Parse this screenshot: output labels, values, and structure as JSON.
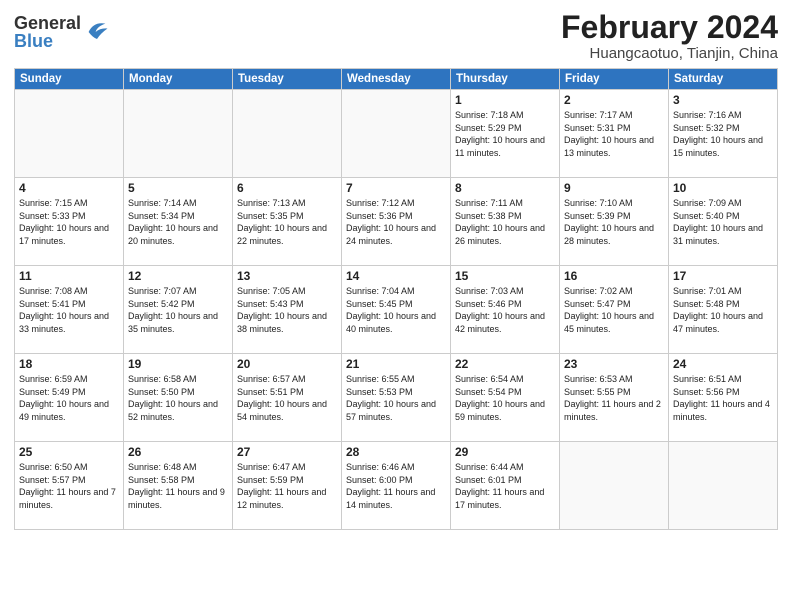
{
  "header": {
    "logo_general": "General",
    "logo_blue": "Blue",
    "month_year": "February 2024",
    "location": "Huangcaotuo, Tianjin, China"
  },
  "weekdays": [
    "Sunday",
    "Monday",
    "Tuesday",
    "Wednesday",
    "Thursday",
    "Friday",
    "Saturday"
  ],
  "weeks": [
    [
      {
        "day": "",
        "empty": true
      },
      {
        "day": "",
        "empty": true
      },
      {
        "day": "",
        "empty": true
      },
      {
        "day": "",
        "empty": true
      },
      {
        "day": "1",
        "sunrise": "7:18 AM",
        "sunset": "5:29 PM",
        "daylight": "10 hours and 11 minutes."
      },
      {
        "day": "2",
        "sunrise": "7:17 AM",
        "sunset": "5:31 PM",
        "daylight": "10 hours and 13 minutes."
      },
      {
        "day": "3",
        "sunrise": "7:16 AM",
        "sunset": "5:32 PM",
        "daylight": "10 hours and 15 minutes."
      }
    ],
    [
      {
        "day": "4",
        "sunrise": "7:15 AM",
        "sunset": "5:33 PM",
        "daylight": "10 hours and 17 minutes."
      },
      {
        "day": "5",
        "sunrise": "7:14 AM",
        "sunset": "5:34 PM",
        "daylight": "10 hours and 20 minutes."
      },
      {
        "day": "6",
        "sunrise": "7:13 AM",
        "sunset": "5:35 PM",
        "daylight": "10 hours and 22 minutes."
      },
      {
        "day": "7",
        "sunrise": "7:12 AM",
        "sunset": "5:36 PM",
        "daylight": "10 hours and 24 minutes."
      },
      {
        "day": "8",
        "sunrise": "7:11 AM",
        "sunset": "5:38 PM",
        "daylight": "10 hours and 26 minutes."
      },
      {
        "day": "9",
        "sunrise": "7:10 AM",
        "sunset": "5:39 PM",
        "daylight": "10 hours and 28 minutes."
      },
      {
        "day": "10",
        "sunrise": "7:09 AM",
        "sunset": "5:40 PM",
        "daylight": "10 hours and 31 minutes."
      }
    ],
    [
      {
        "day": "11",
        "sunrise": "7:08 AM",
        "sunset": "5:41 PM",
        "daylight": "10 hours and 33 minutes."
      },
      {
        "day": "12",
        "sunrise": "7:07 AM",
        "sunset": "5:42 PM",
        "daylight": "10 hours and 35 minutes."
      },
      {
        "day": "13",
        "sunrise": "7:05 AM",
        "sunset": "5:43 PM",
        "daylight": "10 hours and 38 minutes."
      },
      {
        "day": "14",
        "sunrise": "7:04 AM",
        "sunset": "5:45 PM",
        "daylight": "10 hours and 40 minutes."
      },
      {
        "day": "15",
        "sunrise": "7:03 AM",
        "sunset": "5:46 PM",
        "daylight": "10 hours and 42 minutes."
      },
      {
        "day": "16",
        "sunrise": "7:02 AM",
        "sunset": "5:47 PM",
        "daylight": "10 hours and 45 minutes."
      },
      {
        "day": "17",
        "sunrise": "7:01 AM",
        "sunset": "5:48 PM",
        "daylight": "10 hours and 47 minutes."
      }
    ],
    [
      {
        "day": "18",
        "sunrise": "6:59 AM",
        "sunset": "5:49 PM",
        "daylight": "10 hours and 49 minutes."
      },
      {
        "day": "19",
        "sunrise": "6:58 AM",
        "sunset": "5:50 PM",
        "daylight": "10 hours and 52 minutes."
      },
      {
        "day": "20",
        "sunrise": "6:57 AM",
        "sunset": "5:51 PM",
        "daylight": "10 hours and 54 minutes."
      },
      {
        "day": "21",
        "sunrise": "6:55 AM",
        "sunset": "5:53 PM",
        "daylight": "10 hours and 57 minutes."
      },
      {
        "day": "22",
        "sunrise": "6:54 AM",
        "sunset": "5:54 PM",
        "daylight": "10 hours and 59 minutes."
      },
      {
        "day": "23",
        "sunrise": "6:53 AM",
        "sunset": "5:55 PM",
        "daylight": "11 hours and 2 minutes."
      },
      {
        "day": "24",
        "sunrise": "6:51 AM",
        "sunset": "5:56 PM",
        "daylight": "11 hours and 4 minutes."
      }
    ],
    [
      {
        "day": "25",
        "sunrise": "6:50 AM",
        "sunset": "5:57 PM",
        "daylight": "11 hours and 7 minutes."
      },
      {
        "day": "26",
        "sunrise": "6:48 AM",
        "sunset": "5:58 PM",
        "daylight": "11 hours and 9 minutes."
      },
      {
        "day": "27",
        "sunrise": "6:47 AM",
        "sunset": "5:59 PM",
        "daylight": "11 hours and 12 minutes."
      },
      {
        "day": "28",
        "sunrise": "6:46 AM",
        "sunset": "6:00 PM",
        "daylight": "11 hours and 14 minutes."
      },
      {
        "day": "29",
        "sunrise": "6:44 AM",
        "sunset": "6:01 PM",
        "daylight": "11 hours and 17 minutes."
      },
      {
        "day": "",
        "empty": true
      },
      {
        "day": "",
        "empty": true
      }
    ]
  ],
  "labels": {
    "sunrise_label": "Sunrise:",
    "sunset_label": "Sunset:",
    "daylight_label": "Daylight:"
  }
}
